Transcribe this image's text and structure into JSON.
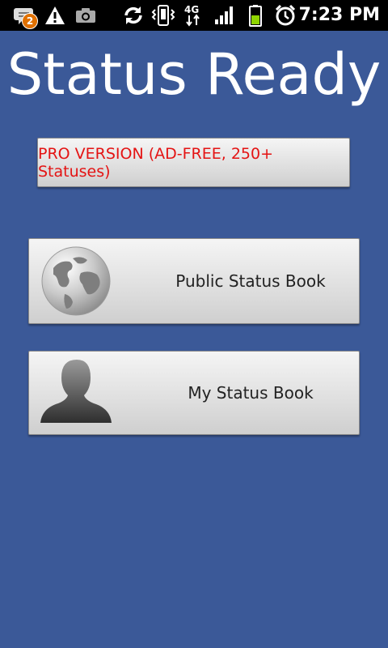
{
  "status_bar": {
    "notification_count": "2",
    "time": "7:23 PM",
    "icons": [
      "chat-notification-icon",
      "warning-icon",
      "camera-icon",
      "sync-icon",
      "vibrate-icon",
      "4g-icon",
      "signal-icon",
      "battery-icon",
      "alarm-icon"
    ]
  },
  "app": {
    "title": "Status Ready"
  },
  "buttons": {
    "pro_label": "PRO VERSION (AD-FREE, 250+ Statuses)",
    "public_label": "Public Status Book",
    "my_label": "My Status Book"
  },
  "colors": {
    "background": "#3b5998",
    "pro_text": "#e41313"
  }
}
